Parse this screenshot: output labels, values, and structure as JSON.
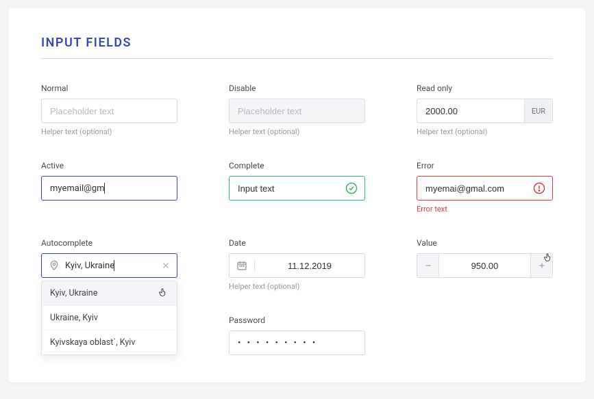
{
  "title": "INPUT FIELDS",
  "normal": {
    "label": "Normal",
    "placeholder": "Placeholder text",
    "helper": "Helper text (optional)"
  },
  "disable": {
    "label": "Disable",
    "placeholder": "Placeholder text",
    "helper": "Helper text (optional)"
  },
  "readonly": {
    "label": "Read only",
    "value": "2000.00",
    "suffix": "EUR",
    "helper": "Helper text (optional)"
  },
  "active": {
    "label": "Active",
    "value": "myemail@gm"
  },
  "complete": {
    "label": "Complete",
    "value": "Input text"
  },
  "error": {
    "label": "Error",
    "value": "myemai@gmal.com",
    "helper": "Error text"
  },
  "autocomplete": {
    "label": "Autocomplete",
    "value": "Kyiv, Ukraine",
    "options": [
      "Kyiv, Ukraine",
      "Ukraine, Kyiv",
      "Kyivskaya oblast`, Kyiv"
    ]
  },
  "date": {
    "label": "Date",
    "value": "11.12.2019",
    "helper": "Helper text (optional)"
  },
  "valuefield": {
    "label": "Value",
    "value": "950.00"
  },
  "password": {
    "label": "Password",
    "mask": "• • • • • • • • •"
  }
}
